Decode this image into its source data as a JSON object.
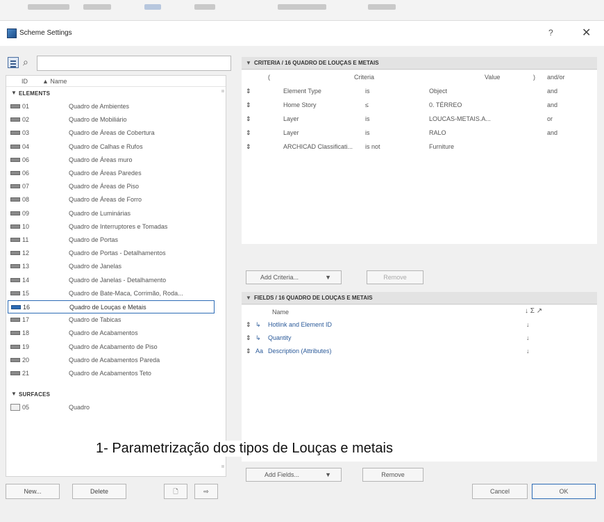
{
  "window": {
    "title": "Scheme Settings",
    "help": "?",
    "close": "✕"
  },
  "search": {
    "glyph": "⌕",
    "value": ""
  },
  "list": {
    "headers": {
      "id": "ID",
      "name": "▲ Name"
    },
    "elements_label": "ELEMENTS",
    "surfaces_label": "SURFACES",
    "rows": [
      {
        "id": "01",
        "name": "Quadro de Ambientes"
      },
      {
        "id": "02",
        "name": "Quadro de Mobiliário"
      },
      {
        "id": "03",
        "name": "Quadro de Áreas de Cobertura"
      },
      {
        "id": "04",
        "name": "Quadro de Calhas e Rufos"
      },
      {
        "id": "06",
        "name": "Quadro de Áreas muro"
      },
      {
        "id": "06",
        "name": "Quadro de Áreas Paredes"
      },
      {
        "id": "07",
        "name": "Quadro de Áreas de Piso"
      },
      {
        "id": "08",
        "name": "Quadro de Áreas de Forro"
      },
      {
        "id": "09",
        "name": "Quadro de Luminárias"
      },
      {
        "id": "10",
        "name": "Quadro de Interruptores e Tomadas"
      },
      {
        "id": "11",
        "name": "Quadro de Portas"
      },
      {
        "id": "12",
        "name": "Quadro de Portas - Detalhamentos"
      },
      {
        "id": "13",
        "name": "Quadro de Janelas"
      },
      {
        "id": "14",
        "name": "Quadro de Janelas - Detalhamento"
      },
      {
        "id": "15",
        "name": "Quadro de Bate-Maca, Corrimão, Roda..."
      },
      {
        "id": "16",
        "name": "Quadro de Louças e Metais"
      },
      {
        "id": "17",
        "name": "Quadro de Tabicas"
      },
      {
        "id": "18",
        "name": "Quadro de Acabamentos"
      },
      {
        "id": "19",
        "name": "Quadro de Acabamento de Piso"
      },
      {
        "id": "20",
        "name": "Quadro de Acabamentos Pareda"
      },
      {
        "id": "21",
        "name": "Quadro de Acabamentos Teto"
      }
    ],
    "surface_row": {
      "id": "05",
      "name": "Quadro"
    }
  },
  "bottom_buttons": {
    "new": "New...",
    "delete": "Delete"
  },
  "criteria": {
    "header": "CRITERIA / 16 QUADRO DE LOUÇAS E METAIS",
    "columns": {
      "paren_open": "(",
      "criteria": "Criteria",
      "value": "Value",
      "paren_close": ")",
      "andor": "and/or"
    },
    "rows": [
      {
        "field": "Element Type",
        "op": "is",
        "value": "Object",
        "andor": "and"
      },
      {
        "field": "Home Story",
        "op": "≤",
        "value": "0. TÉRREO",
        "andor": "and"
      },
      {
        "field": "Layer",
        "op": "is",
        "value": "LOUCAS-METAIS.A...",
        "andor": "or"
      },
      {
        "field": "Layer",
        "op": "is",
        "value": "RALO",
        "andor": "and"
      },
      {
        "field": "ARCHICAD Classificati...",
        "op": "is not",
        "value": "Furniture",
        "andor": ""
      }
    ],
    "add_label": "Add Criteria...",
    "remove_label": "Remove"
  },
  "fields": {
    "header": "FIELDS / 16 QUADRO DE LOUÇAS E METAIS",
    "name_col": "Name",
    "col_icons": "↓ Σ ↗",
    "rows": [
      {
        "name": "Hotlink and Element ID",
        "sort": "↓"
      },
      {
        "name": "Quantity",
        "sort": "↓"
      },
      {
        "name": "Description (Attributes)",
        "sort": "↓"
      }
    ],
    "add_label": "Add Fields...",
    "remove_label": "Remove"
  },
  "footer": {
    "cancel": "Cancel",
    "ok": "OK"
  },
  "caption": "1- Parametrização dos tipos de Louças e metais"
}
